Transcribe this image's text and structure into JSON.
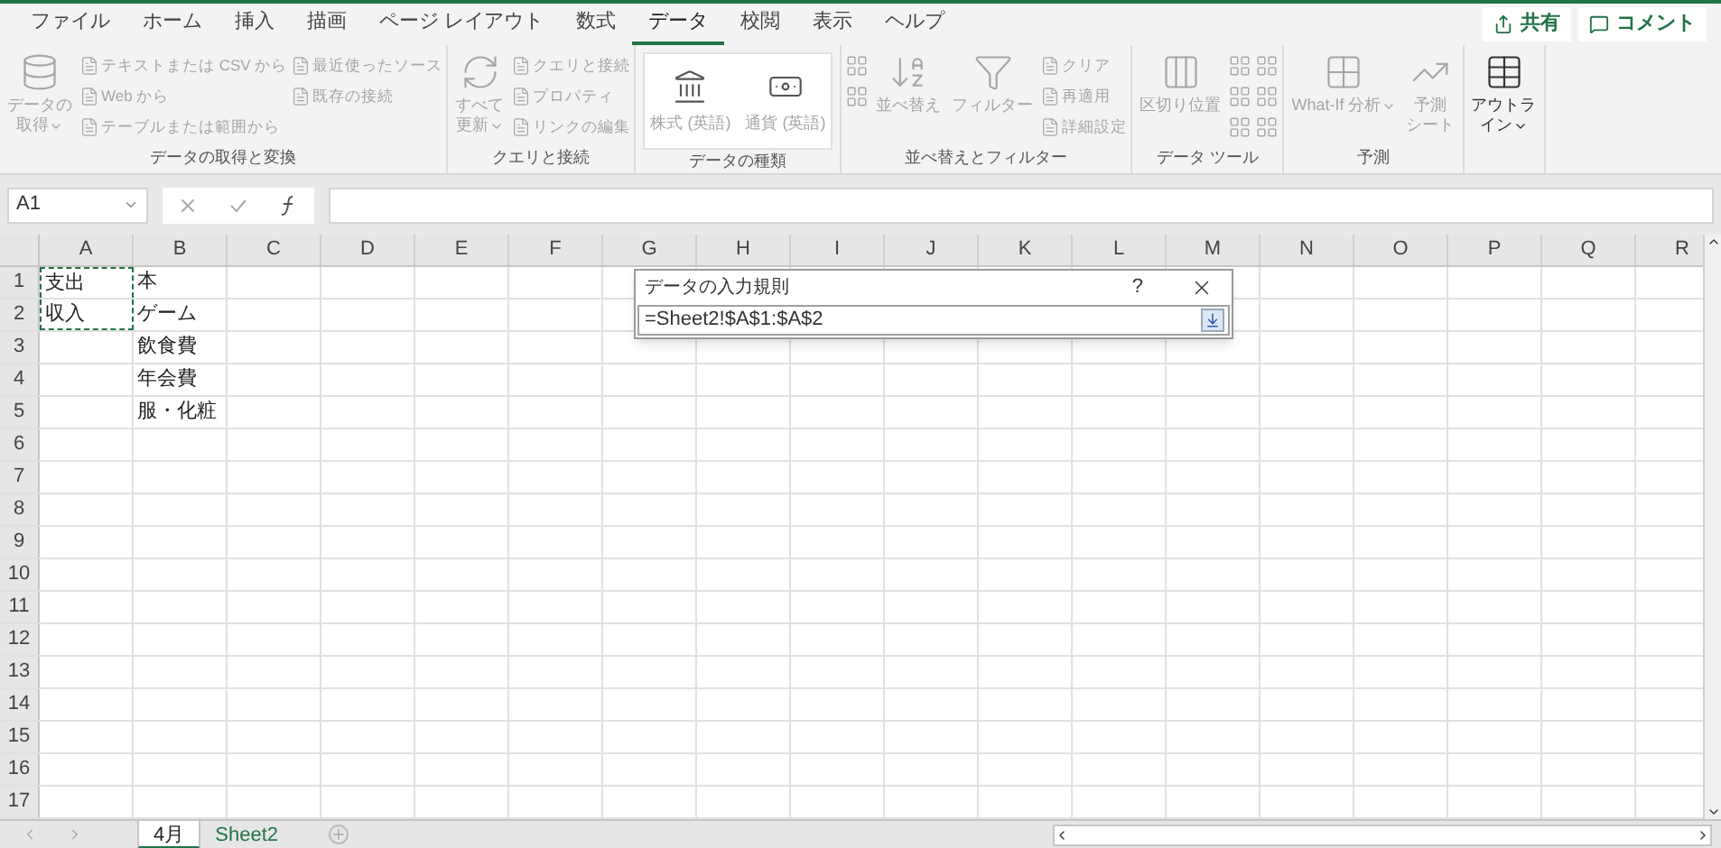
{
  "menu_tabs": [
    {
      "label": "ファイル",
      "selected": false
    },
    {
      "label": "ホーム",
      "selected": false
    },
    {
      "label": "挿入",
      "selected": false
    },
    {
      "label": "描画",
      "selected": false
    },
    {
      "label": "ページ レイアウト",
      "selected": false
    },
    {
      "label": "数式",
      "selected": false
    },
    {
      "label": "データ",
      "selected": true
    },
    {
      "label": "校閲",
      "selected": false
    },
    {
      "label": "表示",
      "selected": false
    },
    {
      "label": "ヘルプ",
      "selected": false
    }
  ],
  "share_button": "共有",
  "comment_button": "コメント",
  "ribbon_groups": [
    {
      "label": "データの取得と変換",
      "columns": [
        [
          {
            "kind": "large",
            "lines": [
              "データの",
              "取得"
            ],
            "caret": true,
            "disabled": true
          }
        ],
        [
          {
            "kind": "small",
            "label": "テキストまたは CSV から",
            "disabled": true
          },
          {
            "kind": "small",
            "label": "Web から",
            "disabled": true
          },
          {
            "kind": "small",
            "label": "テーブルまたは範囲から",
            "disabled": true
          }
        ],
        [
          {
            "kind": "small",
            "label": "最近使ったソース",
            "disabled": true
          },
          {
            "kind": "small",
            "label": "既存の接続",
            "disabled": true
          }
        ]
      ]
    },
    {
      "label": "クエリと接続",
      "columns": [
        [
          {
            "kind": "large",
            "lines": [
              "すべて",
              "更新"
            ],
            "caret": true,
            "disabled": true
          }
        ],
        [
          {
            "kind": "small",
            "label": "クエリと接続",
            "disabled": true
          },
          {
            "kind": "small",
            "label": "プロパティ",
            "disabled": true
          },
          {
            "kind": "small",
            "label": "リンクの編集",
            "disabled": true
          }
        ]
      ]
    },
    {
      "label": "データの種類",
      "columns": [
        [
          {
            "kind": "gallery",
            "label": "株式 (英語)",
            "disabled": true
          }
        ],
        [
          {
            "kind": "gallery",
            "label": "通貨 (英語)",
            "disabled": true
          }
        ]
      ]
    },
    {
      "label": "並べ替えとフィルター",
      "columns": [
        [
          {
            "kind": "icon",
            "disabled": true
          },
          {
            "kind": "icon",
            "disabled": true
          }
        ],
        [
          {
            "kind": "large",
            "lines": [
              "並べ替え"
            ],
            "caret": false,
            "disabled": true
          }
        ],
        [
          {
            "kind": "large",
            "lines": [
              "フィルター"
            ],
            "caret": false,
            "disabled": true
          }
        ],
        [
          {
            "kind": "small",
            "label": "クリア",
            "disabled": true
          },
          {
            "kind": "small",
            "label": "再適用",
            "disabled": true
          },
          {
            "kind": "small",
            "label": "詳細設定",
            "disabled": true
          }
        ]
      ]
    },
    {
      "label": "データ ツール",
      "columns": [
        [
          {
            "kind": "large",
            "lines": [
              "区切り位置"
            ],
            "caret": false,
            "disabled": true
          }
        ],
        [
          {
            "kind": "icon",
            "disabled": true
          },
          {
            "kind": "icon",
            "disabled": true
          },
          {
            "kind": "icon",
            "disabled": true
          }
        ],
        [
          {
            "kind": "icon",
            "disabled": true
          },
          {
            "kind": "icon",
            "disabled": true
          },
          {
            "kind": "icon",
            "disabled": true
          }
        ]
      ]
    },
    {
      "label": "予測",
      "columns": [
        [
          {
            "kind": "large",
            "lines": [
              "What-If 分析"
            ],
            "caret": true,
            "disabled": true
          }
        ],
        [
          {
            "kind": "large",
            "lines": [
              "予測",
              "シート"
            ],
            "caret": false,
            "disabled": true
          }
        ]
      ]
    },
    {
      "columns": [
        [
          {
            "kind": "large",
            "lines": [
              "アウトラ",
              "イン"
            ],
            "caret": true,
            "disabled": false
          }
        ]
      ]
    }
  ],
  "name_box": "A1",
  "columns": [
    "A",
    "B",
    "C",
    "D",
    "E",
    "F",
    "G",
    "H",
    "I",
    "J",
    "K",
    "L",
    "M",
    "N",
    "O",
    "P",
    "Q",
    "R"
  ],
  "rows": [
    {
      "number": "1",
      "cells": [
        "支出",
        "本"
      ],
      "marked": true
    },
    {
      "number": "2",
      "cells": [
        "収入",
        "ゲーム"
      ],
      "marked": true
    },
    {
      "number": "3",
      "cells": [
        "",
        "飲食費"
      ],
      "marked": false
    },
    {
      "number": "4",
      "cells": [
        "",
        "年会費"
      ],
      "marked": false
    },
    {
      "number": "5",
      "cells": [
        "",
        "服・化粧"
      ],
      "marked": false
    },
    {
      "number": "6",
      "cells": [],
      "marked": false
    },
    {
      "number": "7",
      "cells": [],
      "marked": false
    },
    {
      "number": "8",
      "cells": [],
      "marked": false
    },
    {
      "number": "9",
      "cells": [],
      "marked": false
    },
    {
      "number": "10",
      "cells": [],
      "marked": false
    },
    {
      "number": "11",
      "cells": [],
      "marked": false
    },
    {
      "number": "12",
      "cells": [],
      "marked": false
    },
    {
      "number": "13",
      "cells": [],
      "marked": false
    },
    {
      "number": "14",
      "cells": [],
      "marked": false
    },
    {
      "number": "15",
      "cells": [],
      "marked": false
    },
    {
      "number": "16",
      "cells": [],
      "marked": false
    },
    {
      "number": "17",
      "cells": [],
      "marked": false
    }
  ],
  "dialog": {
    "title": "データの入力規則",
    "help": "?",
    "value": "=Sheet2!$A$1:$A$2"
  },
  "sheet_tabs": [
    {
      "label": "4月",
      "selected": true,
      "referenced": false
    },
    {
      "label": "Sheet2",
      "selected": false,
      "referenced": true
    }
  ]
}
